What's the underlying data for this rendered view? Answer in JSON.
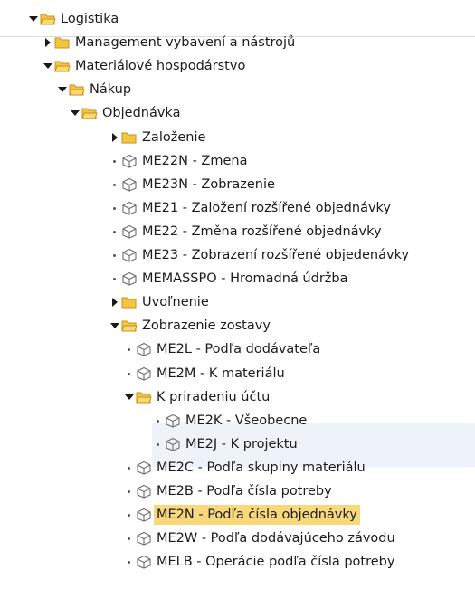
{
  "tree": [
    {
      "label": "Logistika",
      "level": 0,
      "type": "folder",
      "state": "open"
    },
    {
      "label": "Management vybavení a nástrojů",
      "level": 1,
      "type": "folder",
      "state": "closed"
    },
    {
      "label": "Materiálové hospodárstvo",
      "level": 1,
      "type": "folder",
      "state": "open"
    },
    {
      "label": "Nákup",
      "level": 2,
      "type": "folder",
      "state": "open"
    },
    {
      "label": "Objednávka",
      "level": 3,
      "type": "folder",
      "state": "open"
    },
    {
      "label": "Založenie",
      "level": 4,
      "type": "folder",
      "state": "closed"
    },
    {
      "label": "ME22N - Zmena",
      "level": 4,
      "type": "transaction"
    },
    {
      "label": "ME23N - Zobrazenie",
      "level": 4,
      "type": "transaction"
    },
    {
      "label": "ME21 - Založení rozšířené objednávky",
      "level": 4,
      "type": "transaction"
    },
    {
      "label": "ME22 - Změna rozšířené objednávky",
      "level": 4,
      "type": "transaction"
    },
    {
      "label": "ME23 - Zobrazení rozšířené objedenávky",
      "level": 4,
      "type": "transaction"
    },
    {
      "label": "MEMASSPO - Hromadná údržba",
      "level": 4,
      "type": "transaction"
    },
    {
      "label": "Uvoľnenie",
      "level": 4,
      "type": "folder",
      "state": "closed"
    },
    {
      "label": "Zobrazenie zostavy",
      "level": 4,
      "type": "folder",
      "state": "open"
    },
    {
      "label": "ME2L - Podľa dodávateľa",
      "level": 5,
      "type": "transaction"
    },
    {
      "label": "ME2M - K materiálu",
      "level": 5,
      "type": "transaction"
    },
    {
      "label": "K priradeniu účtu",
      "level": 5,
      "type": "folder",
      "state": "open"
    },
    {
      "label": "ME2K - Všeobecne",
      "level": 6,
      "type": "transaction"
    },
    {
      "label": "ME2J - K projektu",
      "level": 6,
      "type": "transaction"
    },
    {
      "label": "ME2C - Podľa skupiny materiálu",
      "level": 5,
      "type": "transaction"
    },
    {
      "label": "ME2B - Podľa čísla potreby",
      "level": 5,
      "type": "transaction"
    },
    {
      "label": "ME2N - Podľa čísla objednávky",
      "level": 5,
      "type": "transaction",
      "selected": true
    },
    {
      "label": "ME2W - Podľa dodávajúceho závodu",
      "level": 5,
      "type": "transaction"
    },
    {
      "label": "MELB - Operácie podľa čísla potreby",
      "level": 5,
      "type": "transaction"
    }
  ],
  "colors": {
    "folder_fill": "#f4c542",
    "folder_stroke": "#c9921a",
    "selected_bg": "#f9d87c",
    "transaction_icon": "#6d6d6d"
  }
}
